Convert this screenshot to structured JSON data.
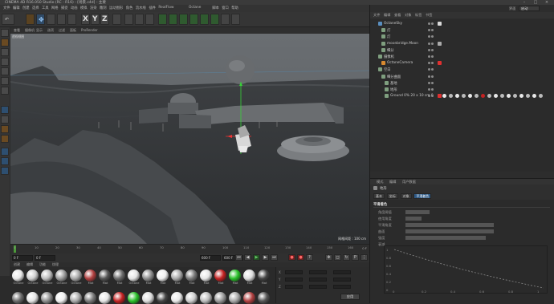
{
  "window": {
    "title": "CINEMA 4D R16.050 Studio (RC - R16) - [场景.c4d] - 主要"
  },
  "menubar": {
    "items": [
      "文件",
      "编辑",
      "创建",
      "选择",
      "工具",
      "网格",
      "捕捉",
      "动画",
      "模拟",
      "渲染",
      "雕刻",
      "运动图形",
      "角色",
      "流水线",
      "插件",
      "RealFlow",
      "Octane",
      "脚本",
      "窗口",
      "帮助"
    ]
  },
  "layout": {
    "label": "界面",
    "value": "启动"
  },
  "viewport": {
    "menu": [
      "查看",
      "摄像机",
      "显示",
      "选项",
      "过滤",
      "面板",
      "ProRender"
    ],
    "label": "透视视图",
    "grid_readout": "网格间距 : 100 cm"
  },
  "timeline": {
    "ticks": [
      "0",
      "10",
      "20",
      "30",
      "40",
      "50",
      "60",
      "70",
      "80",
      "90",
      "100",
      "110",
      "120",
      "130",
      "140",
      "150",
      "160"
    ],
    "frame_end": "0 F"
  },
  "playbar": {
    "frame_start": "0 F",
    "frame_cur": "0 F",
    "frame_total": "600 F",
    "frame_end2": "600 F"
  },
  "material_menu": [
    "创建",
    "编辑",
    "功能",
    "纹理"
  ],
  "materials": [
    {
      "name": "Octane",
      "color": "#e8e8e8"
    },
    {
      "name": "Octane",
      "color": "#cfcfcf"
    },
    {
      "name": "Octane",
      "color": "#bdbdbd"
    },
    {
      "name": "Octane",
      "color": "#9a9a9a"
    },
    {
      "name": "Octane",
      "color": "#a8a8a8"
    },
    {
      "name": "Mat",
      "color": "#b04040"
    },
    {
      "name": "Mat",
      "color": "#555"
    },
    {
      "name": "Mat",
      "color": "#6b6b6b"
    },
    {
      "name": "Octane",
      "color": "#e5e5e5"
    },
    {
      "name": "Mat",
      "color": "#8e8e8e"
    },
    {
      "name": "Mat",
      "color": "#f0f0f0"
    },
    {
      "name": "Mat",
      "color": "#aaaaaa"
    },
    {
      "name": "Mat",
      "color": "#7a7a7a"
    },
    {
      "name": "Mat",
      "color": "#e6e6e6"
    },
    {
      "name": "Mat",
      "color": "#c42222"
    },
    {
      "name": "Mat",
      "color": "#2ac02a"
    },
    {
      "name": "Mat",
      "color": "#dddddd"
    },
    {
      "name": "Mat",
      "color": "#444"
    }
  ],
  "coords": {
    "rows": [
      "X",
      "Y",
      "Z"
    ],
    "apply": "应用"
  },
  "object_manager": {
    "tabs": [
      "文件",
      "编辑",
      "查看",
      "对象",
      "标签",
      "书签"
    ],
    "rows": [
      {
        "name": "OctaneSky",
        "indent": 4
      },
      {
        "name": "灯",
        "indent": 8
      },
      {
        "name": "灯",
        "indent": 8
      },
      {
        "name": "moonbridge.Moon",
        "indent": 8
      },
      {
        "name": "细分",
        "indent": 8
      },
      {
        "name": "摄像机",
        "indent": 4
      },
      {
        "name": "OctaneCamera",
        "indent": 8
      },
      {
        "name": "空白",
        "indent": 4
      },
      {
        "name": "细分曲面",
        "indent": 8
      },
      {
        "name": "基地",
        "indent": 12
      },
      {
        "name": "地形",
        "indent": 12
      },
      {
        "name": "Ground 0% 20 x 10 cm 0",
        "indent": 12
      }
    ]
  },
  "attributes": {
    "tabs": [
      "模式",
      "编辑",
      "用户数据"
    ],
    "object_label": "地形",
    "subtabs": [
      "基本",
      "坐标",
      "对象",
      "平滑着色"
    ],
    "active_subtab": "平滑着色",
    "section": "平滑着色",
    "rows": [
      "角度阈值",
      "使用角度",
      "平滑角度",
      "曲面",
      "强度",
      "衰减"
    ],
    "curve_y": [
      "1",
      "0.8",
      "0.6",
      "0.4",
      "0.2",
      "0"
    ],
    "curve_x": [
      "0",
      "0.2",
      "0.4",
      "0.6",
      "0.8",
      "1"
    ]
  }
}
